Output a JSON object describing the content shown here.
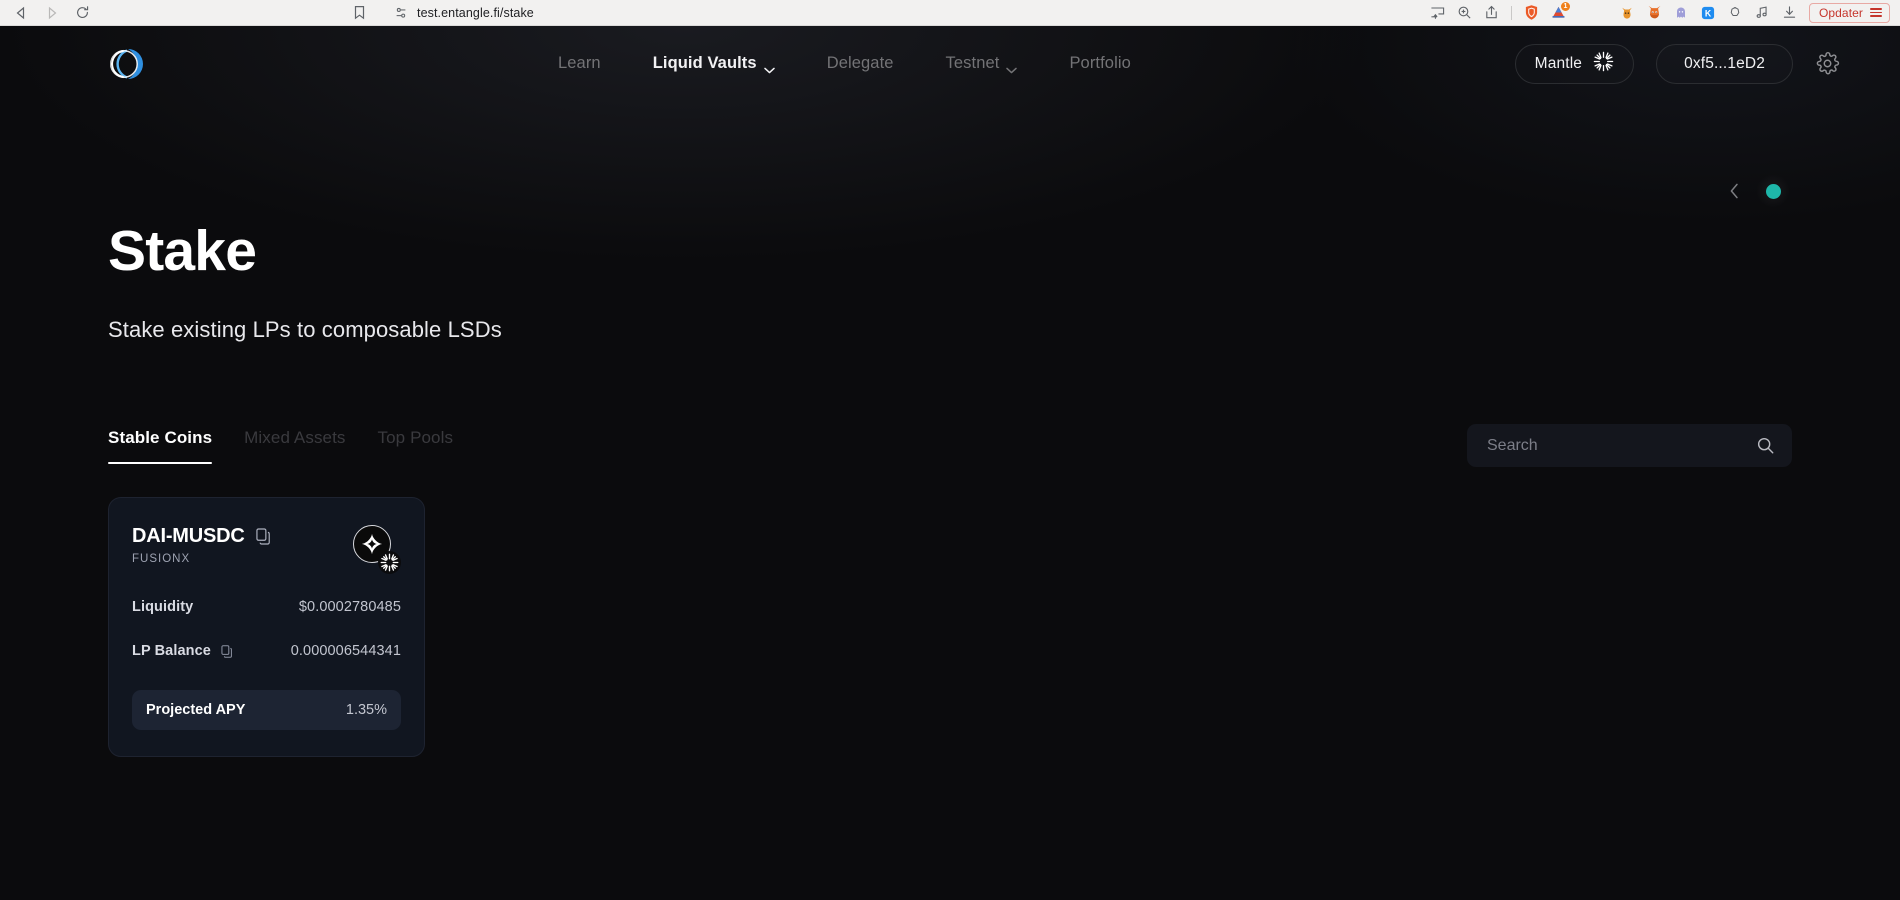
{
  "browser": {
    "back_icon": "back-arrow-icon",
    "forward_icon": "forward-arrow-icon",
    "reload_icon": "reload-icon",
    "bookmark_icon": "bookmark-icon",
    "permission_icon": "site-permissions-icon",
    "url": "test.entangle.fi/stake",
    "toolbar_icons": [
      "cast-icon",
      "zoom-icon",
      "share-icon"
    ],
    "extension_icons": [
      "brave-shield-icon",
      "notifications-triangle-icon",
      "fox-icon",
      "metamask-icon",
      "ghost-icon",
      "kaspa-icon",
      "cloud-icon",
      "music-icon",
      "download-icon"
    ],
    "notification_badge": "1",
    "update_button_label": "Opdater",
    "menu_icon": "hamburger-menu-icon"
  },
  "header": {
    "logo_name": "entangle-logo",
    "nav": [
      {
        "label": "Learn",
        "active": false,
        "has_caret": false
      },
      {
        "label": "Liquid Vaults",
        "active": true,
        "has_caret": true
      },
      {
        "label": "Delegate",
        "active": false,
        "has_caret": false
      },
      {
        "label": "Testnet",
        "active": false,
        "has_caret": true
      },
      {
        "label": "Portfolio",
        "active": false,
        "has_caret": false
      }
    ],
    "network_label": "Mantle",
    "network_icon": "mantle-sunburst-icon",
    "wallet_address": "0xf5...1eD2",
    "settings_icon": "gear-icon"
  },
  "carousel": {
    "prev_icon": "chevron-left-icon",
    "dot_color": "#1eb7aa"
  },
  "hero": {
    "title": "Stake",
    "subtitle": "Stake existing LPs to composable LSDs"
  },
  "tabs": [
    {
      "label": "Stable Coins",
      "active": true
    },
    {
      "label": "Mixed Assets",
      "active": false
    },
    {
      "label": "Top Pools",
      "active": false
    }
  ],
  "search": {
    "placeholder": "Search",
    "value": "",
    "icon": "search-icon"
  },
  "pools": [
    {
      "pair": "DAI-MUSDC",
      "protocol": "FUSIONX",
      "copy_icon": "copy-icon",
      "token_icon": "fusionx-star-icon",
      "chain_icon": "mantle-sunburst-icon",
      "stats": [
        {
          "label": "Liquidity",
          "value": "$0.0002780485",
          "has_copy": false
        },
        {
          "label": "LP Balance",
          "value": "0.000006544341",
          "has_copy": true
        }
      ],
      "apy_label": "Projected APY",
      "apy_value": "1.35%"
    }
  ],
  "theme": {
    "app_bg": "#0b0b0d",
    "card_bg": "#111620",
    "apy_bg": "#1d2433",
    "accent_teal": "#1eb7aa",
    "logo_blue": "#2f8fe0"
  }
}
